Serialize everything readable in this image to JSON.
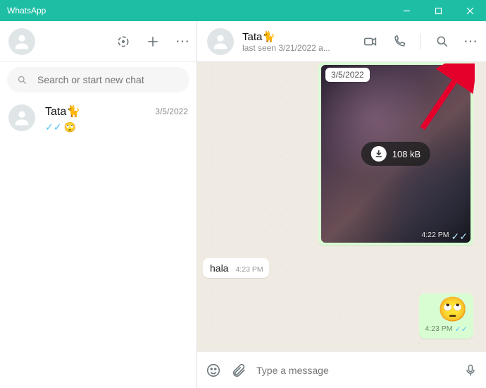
{
  "title": "WhatsApp",
  "left": {
    "search_placeholder": "Search or start new chat",
    "chats": [
      {
        "name": "Tata🐈",
        "when": "3/5/2022",
        "preview_emoji": "🙄",
        "read": true
      }
    ]
  },
  "chat": {
    "name": "Tata🐈",
    "status": "last seen 3/21/2022 a...",
    "media": {
      "date": "3/5/2022",
      "size": "108 kB",
      "time": "4:22 PM"
    },
    "incoming": {
      "text": "hala",
      "time": "4:23 PM"
    },
    "outgoing": {
      "emoji": "🙄",
      "time": "4:23 PM"
    },
    "input_placeholder": "Type a message"
  }
}
